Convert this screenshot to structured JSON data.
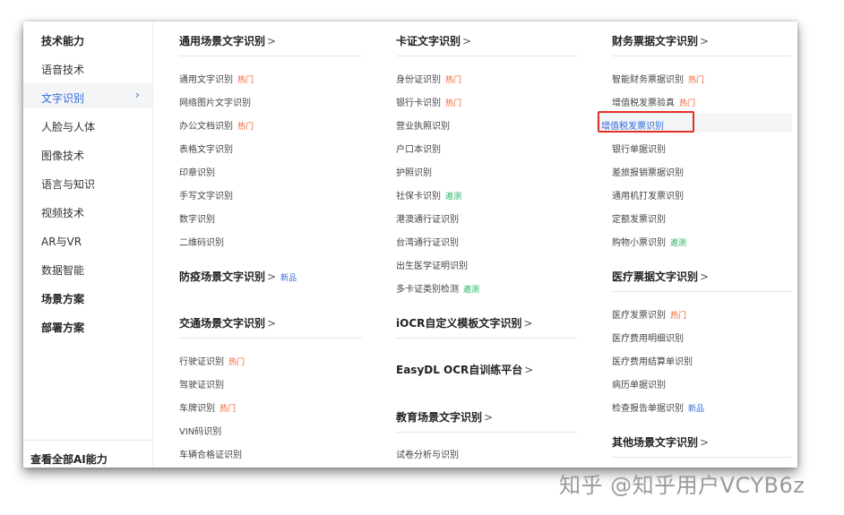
{
  "sidebar": {
    "items": [
      {
        "label": "技术能力",
        "style": "bold"
      },
      {
        "label": "语音技术",
        "style": "normal"
      },
      {
        "label": "文字识别",
        "style": "active"
      },
      {
        "label": "人脸与人体",
        "style": "normal"
      },
      {
        "label": "图像技术",
        "style": "normal"
      },
      {
        "label": "语言与知识",
        "style": "normal"
      },
      {
        "label": "视频技术",
        "style": "normal"
      },
      {
        "label": "AR与VR",
        "style": "normal"
      },
      {
        "label": "数据智能",
        "style": "normal"
      },
      {
        "label": "场景方案",
        "style": "bold"
      },
      {
        "label": "部署方案",
        "style": "bold"
      }
    ],
    "active_chevron": "›",
    "bottom_link": "查看全部AI能力"
  },
  "columns": {
    "col1": {
      "sections": [
        {
          "title": "通用场景文字识别",
          "arrow": ">",
          "items": [
            {
              "label": "通用文字识别",
              "badge": "热门",
              "badge_type": "hot"
            },
            {
              "label": "网络图片文字识别"
            },
            {
              "label": "办公文档识别",
              "badge": "热门",
              "badge_type": "hot"
            },
            {
              "label": "表格文字识别"
            },
            {
              "label": "印章识别"
            },
            {
              "label": "手写文字识别"
            },
            {
              "label": "数字识别"
            },
            {
              "label": "二维码识别"
            }
          ]
        },
        {
          "title": "防疫场景文字识别",
          "arrow": ">",
          "title_badge": "新品",
          "items": []
        },
        {
          "title": "交通场景文字识别",
          "arrow": ">",
          "items": [
            {
              "label": "行驶证识别",
              "badge": "热门",
              "badge_type": "hot"
            },
            {
              "label": "驾驶证识别"
            },
            {
              "label": "车牌识别",
              "badge": "热门",
              "badge_type": "hot"
            },
            {
              "label": "VIN码识别"
            },
            {
              "label": "车辆合格证识别"
            }
          ]
        }
      ]
    },
    "col2": {
      "sections": [
        {
          "title": "卡证文字识别",
          "arrow": ">",
          "items": [
            {
              "label": "身份证识别",
              "badge": "热门",
              "badge_type": "hot"
            },
            {
              "label": "银行卡识别",
              "badge": "热门",
              "badge_type": "hot"
            },
            {
              "label": "营业执照识别"
            },
            {
              "label": "户口本识别"
            },
            {
              "label": "护照识别"
            },
            {
              "label": "社保卡识别",
              "badge": "邀测",
              "badge_type": "test"
            },
            {
              "label": "港澳通行证识别"
            },
            {
              "label": "台湾通行证识别"
            },
            {
              "label": "出生医学证明识别"
            },
            {
              "label": "多卡证类别检测",
              "badge": "邀测",
              "badge_type": "test"
            }
          ]
        },
        {
          "title": "iOCR自定义模板文字识别",
          "arrow": ">",
          "items": []
        },
        {
          "title": "EasyDL OCR自训练平台",
          "arrow": ">",
          "items": []
        },
        {
          "title": "教育场景文字识别",
          "arrow": ">",
          "items": [
            {
              "label": "试卷分析与识别"
            }
          ]
        }
      ]
    },
    "col3": {
      "sections": [
        {
          "title": "财务票据文字识别",
          "arrow": ">",
          "items": [
            {
              "label": "智能财务票据识别",
              "badge": "热门",
              "badge_type": "hot"
            },
            {
              "label": "增值税发票验真",
              "badge": "热门",
              "badge_type": "hot"
            },
            {
              "label": "增值税发票识别",
              "selected": true
            },
            {
              "label": "银行单据识别"
            },
            {
              "label": "差旅报销票据识别"
            },
            {
              "label": "通用机打发票识别"
            },
            {
              "label": "定额发票识别"
            },
            {
              "label": "购物小票识别",
              "badge": "邀测",
              "badge_type": "test"
            }
          ]
        },
        {
          "title": "医疗票据文字识别",
          "arrow": ">",
          "items": [
            {
              "label": "医疗发票识别",
              "badge": "热门",
              "badge_type": "hot"
            },
            {
              "label": "医疗费用明细识别"
            },
            {
              "label": "医疗费用结算单识别"
            },
            {
              "label": "病历单据识别"
            },
            {
              "label": "检查报告单据识别",
              "badge": "新品",
              "badge_type": "new"
            }
          ]
        },
        {
          "title": "其他场景文字识别",
          "arrow": ">",
          "items": []
        }
      ]
    }
  },
  "watermark": "知乎 @知乎用户VCYB6z"
}
